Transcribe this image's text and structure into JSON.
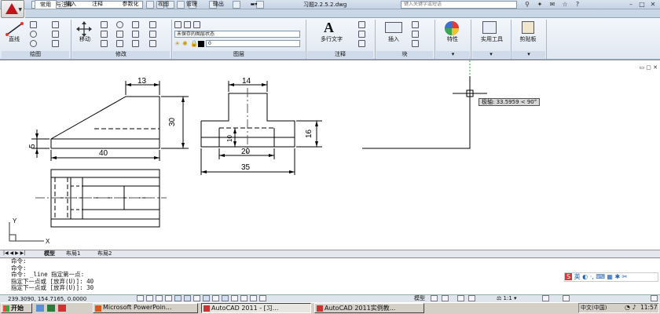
{
  "window": {
    "workspace": "二维草图与注释",
    "doc_title": "习题2.2.5.2.dwg",
    "search_placeholder": "键入关键字或短语"
  },
  "ribbon": {
    "tabs": [
      "常用",
      "插入",
      "注释",
      "参数化",
      "视图",
      "管理",
      "输出"
    ],
    "active_tab": "常用",
    "draw_panel": {
      "line_label": "直线",
      "title": "绘图"
    },
    "modify_panel": {
      "move_label": "移动",
      "title": "修改"
    },
    "layers_panel": {
      "layer_state": "未保存的图层状态",
      "current_layer": "0",
      "title": "图层"
    },
    "annotation_panel": {
      "mtext_label": "多行文字",
      "title": "注释"
    },
    "block_panel": {
      "insert_label": "插入",
      "title": "块"
    },
    "properties_label": "特性",
    "utilities_label": "实用工具",
    "clipboard_label": "剪贴板"
  },
  "drawing": {
    "dimensions": {
      "d13": "13",
      "d30": "30",
      "d5": "5",
      "d40": "40",
      "d14": "14",
      "d10": "10",
      "d16": "16",
      "d20": "20",
      "d35": "35"
    },
    "polar_tooltip": "极轴: 33.5959 < 90°",
    "ucs_x": "X",
    "ucs_y": "Y"
  },
  "layout_tabs": [
    "模型",
    "布局1",
    "布局2"
  ],
  "active_layout": "模型",
  "command_history": [
    "命令:",
    "命令:",
    "命令: _line 指定第一点:",
    "指定下一点或 [放弃(U)]: 40",
    "指定下一点或 [放弃(U)]: 30"
  ],
  "status": {
    "coordinates": "239.3090, 154.7165, 0.0000",
    "model_label": "模型",
    "annotation_scale": "1:1"
  },
  "ime": {
    "lang": "英"
  },
  "taskbar": {
    "start_label": "开始",
    "tasks": [
      "Microsoft PowerPoin...",
      "AutoCAD 2011 - [习...",
      "AutoCAD 2011实例教..."
    ],
    "lang_indicator": "中文(中国)",
    "clock": "11:57"
  },
  "colors": {
    "ribbon_bg": "#dfe7f1",
    "autocad_red": "#c0141a",
    "tooltip_bg": "#d7d7d7"
  }
}
